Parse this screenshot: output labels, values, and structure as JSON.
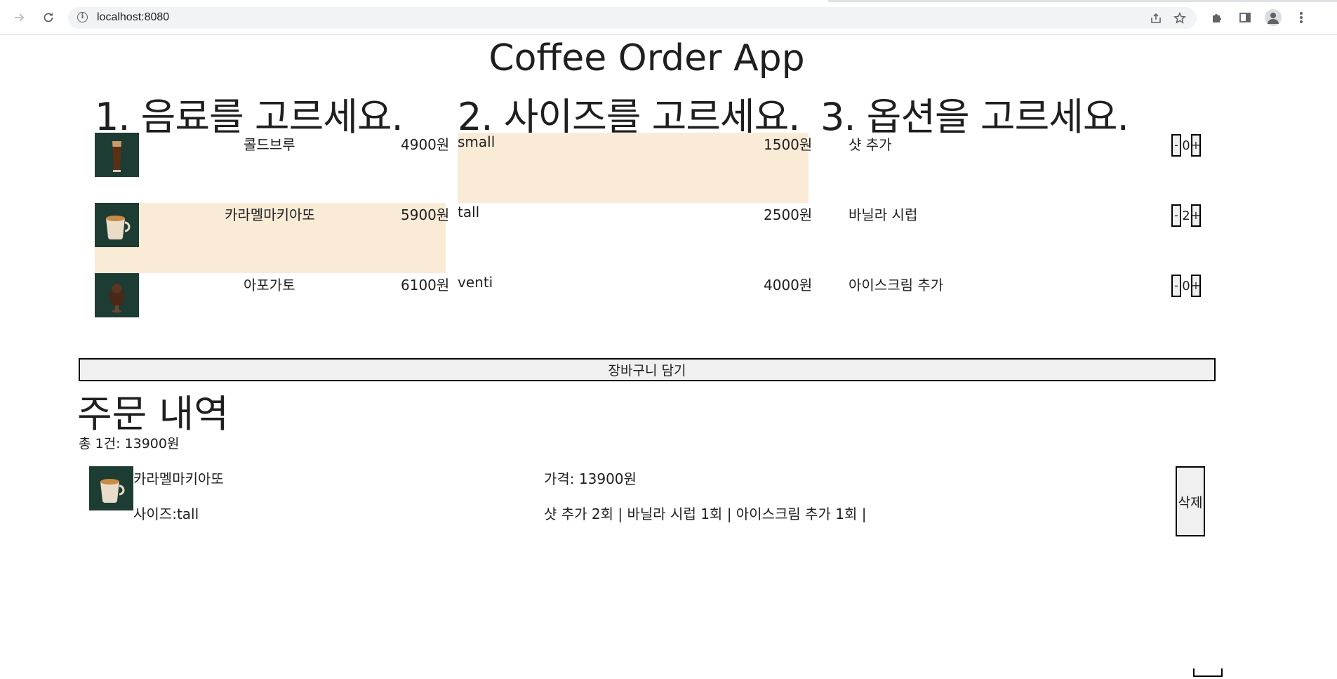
{
  "browser": {
    "url": "localhost:8080",
    "icons": [
      "forward-icon",
      "reload-icon",
      "info-icon",
      "share-icon",
      "star-icon",
      "extensions-icon",
      "side-panel-icon",
      "profile-icon",
      "menu-icon"
    ]
  },
  "app": {
    "title": "Coffee Order App"
  },
  "drinks": {
    "heading": "1. 음료를 고르세요.",
    "items": [
      {
        "name": "콜드브루",
        "price": "4900원",
        "selected": false
      },
      {
        "name": "카라멜마키아또",
        "price": "5900원",
        "selected": true
      },
      {
        "name": "아포가토",
        "price": "6100원",
        "selected": false
      }
    ]
  },
  "sizes": {
    "heading": "2. 사이즈를 고르세요.",
    "items": [
      {
        "name": "small",
        "price": "1500원",
        "selected": true
      },
      {
        "name": "tall",
        "price": "2500원",
        "selected": false
      },
      {
        "name": "venti",
        "price": "4000원",
        "selected": false
      }
    ]
  },
  "options": {
    "heading": "3. 옵션을 고르세요.",
    "minus_label": "-",
    "plus_label": "+",
    "items": [
      {
        "name": "샷 추가",
        "count": "0"
      },
      {
        "name": "바닐라 시럽",
        "count": "2"
      },
      {
        "name": "아이스크림 추가",
        "count": "0"
      }
    ]
  },
  "cart_button": "장바구니 담기",
  "orders": {
    "heading": "주문 내역",
    "total": "총 1건: 13900원",
    "items": [
      {
        "name": "카라멜마키아또",
        "price": "가격: 13900원",
        "size": "사이즈:tall",
        "options": "샷 추가 2회 | 바닐라 시럽 1회 | 아이스크림 추가 1회 |",
        "delete_label": "삭제"
      }
    ]
  },
  "colors": {
    "selected_bg": "#faebd7",
    "thumb_bg": "#1d3c33"
  }
}
